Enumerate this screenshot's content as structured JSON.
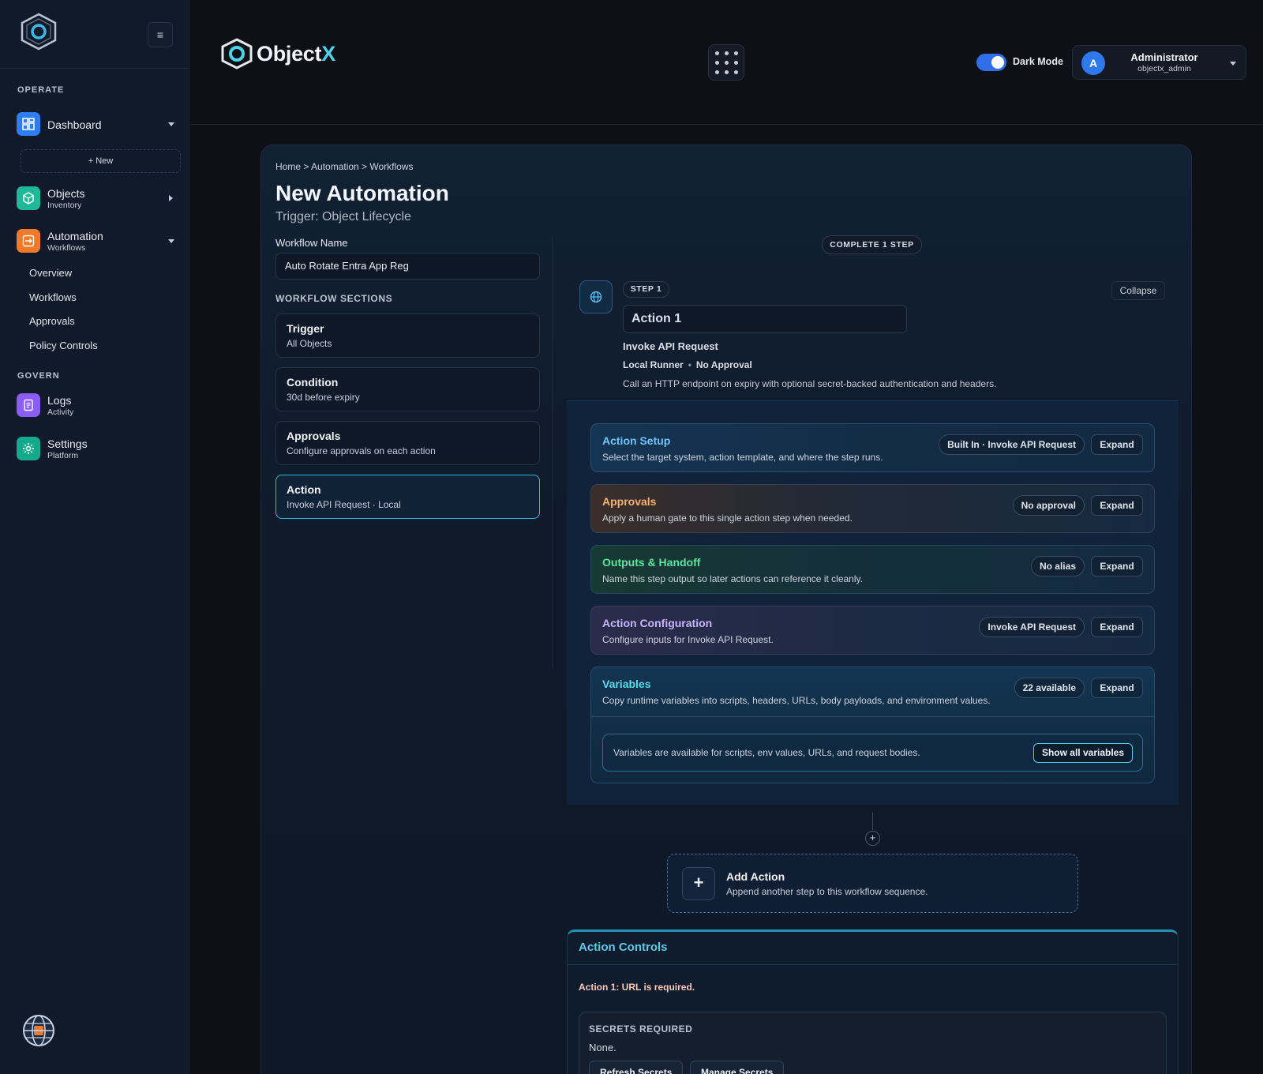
{
  "colors": {
    "accent": "#34b6d9",
    "brand_x": "#4fd2e6",
    "toggle_on": "#2f6fe8",
    "action_setup": "#6fc6ff",
    "approvals": "#ffb26b",
    "outputs": "#5ee6a0",
    "action_config": "#c7b5ff",
    "variables": "#5fd8ea",
    "error": "#ffc9b8"
  },
  "sidebar": {
    "menu_icon": "hamburger-icon",
    "operate_title": "OPERATE",
    "govern_title": "GOVERN",
    "new_label": "+ New",
    "items": {
      "dashboard": {
        "label": "Dashboard",
        "icon": "dashboard-icon",
        "color": "#2f7df0"
      },
      "objects": {
        "label": "Objects",
        "sub": "Inventory",
        "icon": "cube-icon",
        "color": "#1fb899"
      },
      "automation": {
        "label": "Automation",
        "sub": "Workflows",
        "icon": "automation-icon",
        "color": "#f07a2a"
      },
      "logs": {
        "label": "Logs",
        "sub": "Activity",
        "icon": "document-icon",
        "color": "#8b5cf6"
      },
      "settings": {
        "label": "Settings",
        "sub": "Platform",
        "icon": "gear-icon",
        "color": "#14a88c"
      }
    },
    "automation_subitems": [
      "Overview",
      "Workflows",
      "Approvals",
      "Policy Controls"
    ]
  },
  "header": {
    "brand_main": "Object",
    "brand_accent": "X",
    "dark_mode_label": "Dark Mode",
    "dark_mode_on": true,
    "user": {
      "initial": "A",
      "name": "Administrator",
      "handle": "objectx_admin"
    }
  },
  "page": {
    "breadcrumb": "Home > Automation > Workflows",
    "title": "New Automation",
    "subtitle": "Trigger: Object Lifecycle",
    "workflow_name_label": "Workflow Name",
    "workflow_name_value": "Auto Rotate Entra App Reg",
    "sections_title": "WORKFLOW SECTIONS",
    "sections": [
      {
        "name": "Trigger",
        "desc": "All Objects"
      },
      {
        "name": "Condition",
        "desc": "30d before expiry"
      },
      {
        "name": "Approvals",
        "desc": "Configure approvals on each action"
      },
      {
        "name": "Action",
        "desc": "Invoke API Request · Local"
      }
    ]
  },
  "step": {
    "complete_badge": "COMPLETE 1 STEP",
    "badge": "STEP 1",
    "collapse_label": "Collapse",
    "action_name": "Action 1",
    "type": "Invoke API Request",
    "runner": "Local Runner",
    "approval": "No Approval",
    "description": "Call an HTTP endpoint on expiry with optional secret-backed authentication and headers.",
    "expand_label": "Expand",
    "accordions": [
      {
        "title": "Action Setup",
        "desc": "Select the target system, action template, and where the step runs.",
        "tag": "Built In · Invoke API Request"
      },
      {
        "title": "Approvals",
        "desc": "Apply a human gate to this single action step when needed.",
        "tag": "No approval"
      },
      {
        "title": "Outputs & Handoff",
        "desc": "Name this step output so later actions can reference it cleanly.",
        "tag": "No alias"
      },
      {
        "title": "Action Configuration",
        "desc": "Configure inputs for Invoke API Request.",
        "tag": "Invoke API Request"
      },
      {
        "title": "Variables",
        "desc": "Copy runtime variables into scripts, headers, URLs, body payloads, and environment values.",
        "tag": "22 available"
      }
    ],
    "variables_note": "Variables are available for scripts, env values, URLs, and request bodies.",
    "show_all_label": "Show all variables"
  },
  "add_action": {
    "title": "Add Action",
    "desc": "Append another step to this workflow sequence."
  },
  "controls": {
    "title": "Action Controls",
    "error": "Action 1: URL is required.",
    "secrets_title": "SECRETS REQUIRED",
    "secrets_value": "None.",
    "refresh_label": "Refresh Secrets",
    "manage_label": "Manage Secrets"
  }
}
